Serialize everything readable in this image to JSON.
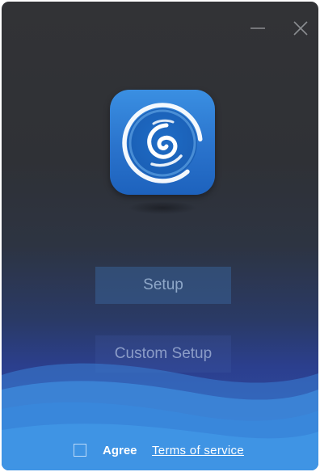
{
  "window": {
    "controls": {
      "minimize_icon": "minimize-icon",
      "close_icon": "close-icon"
    },
    "logo_icon": "app-logo-swirl-icon"
  },
  "actions": {
    "setup_label": "Setup",
    "custom_setup_label": "Custom Setup"
  },
  "agreement": {
    "checked": false,
    "agree_label": "Agree",
    "terms_label": "Terms of service"
  },
  "colors": {
    "logo_blue": "#2a73cc",
    "wave_blue": "#3f8fe0",
    "text_white": "#ffffff"
  }
}
